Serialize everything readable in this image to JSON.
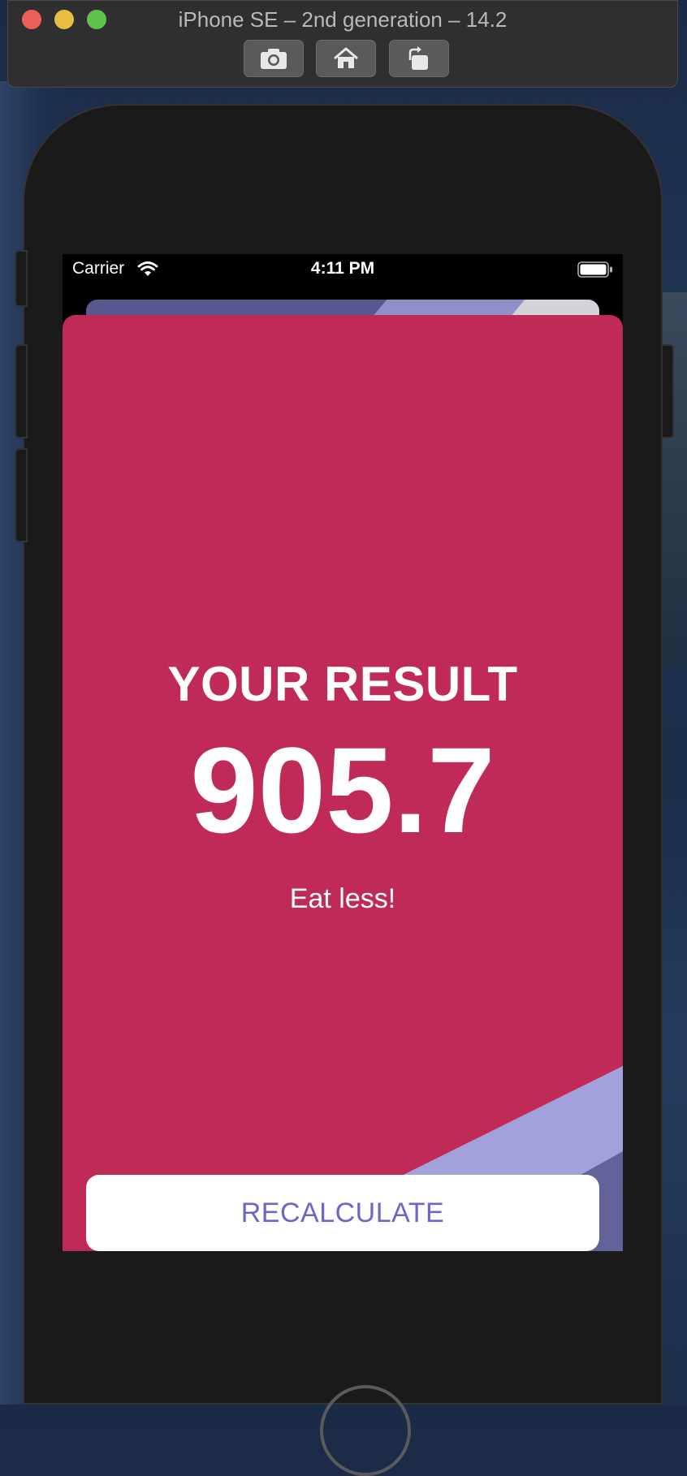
{
  "simulator": {
    "title": "iPhone SE – 2nd generation – 14.2",
    "toolbar_icons": [
      "screenshot-icon",
      "home-icon",
      "rotate-icon"
    ]
  },
  "status_bar": {
    "carrier": "Carrier",
    "time": "4:11 PM"
  },
  "result": {
    "title": "YOUR RESULT",
    "value": "905.7",
    "advice": "Eat less!",
    "recalculate_label": "RECALCULATE"
  },
  "colors": {
    "result_background": "#bf2b56",
    "accent_purple": "#6a67c8",
    "stripe_light_purple": "#a3a1dc",
    "stripe_dark_purple": "#63629a"
  }
}
